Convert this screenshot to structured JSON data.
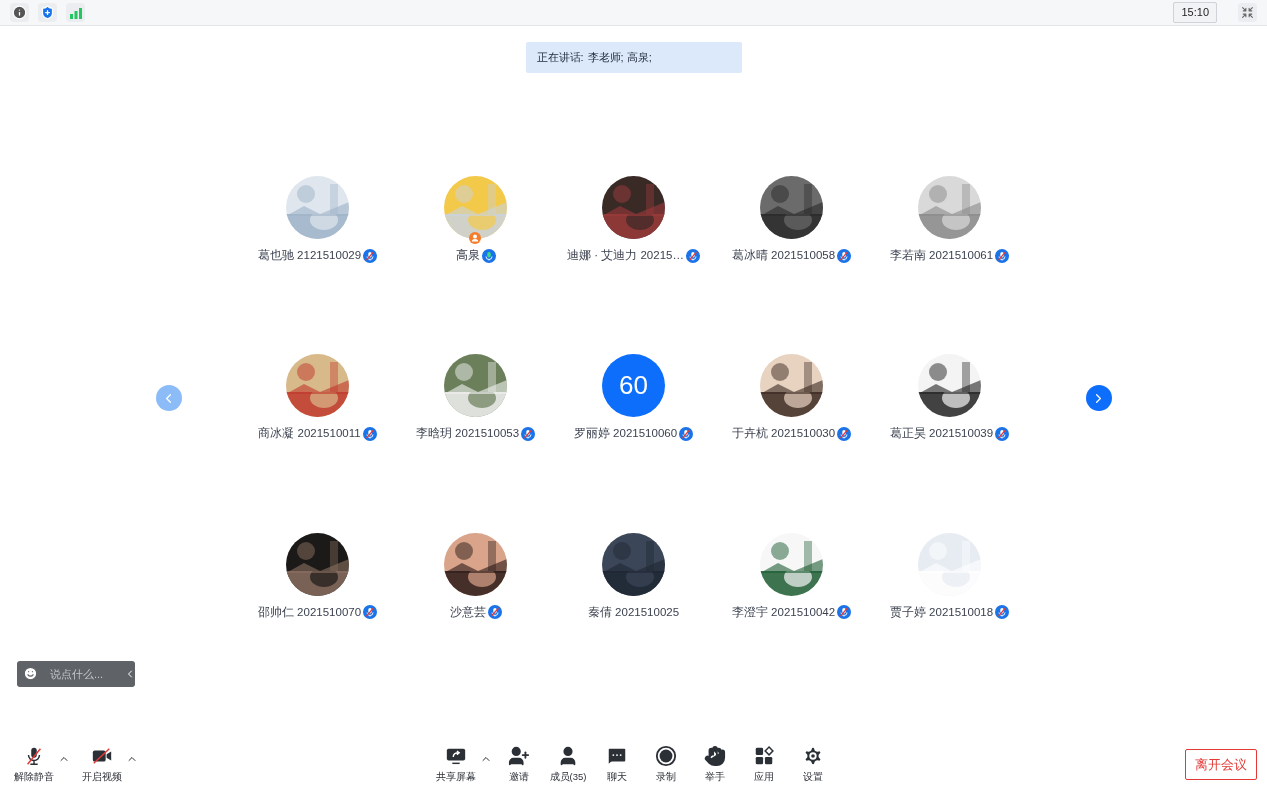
{
  "top_bar": {
    "time": "15:10"
  },
  "speaking_banner": {
    "label": "正在讲话:",
    "names": "李老师; 高泉;"
  },
  "pager": {
    "prev_disabled": true,
    "next_disabled": false
  },
  "participants": [
    {
      "name": "葛也驰 2121510029",
      "muted": true,
      "talking": false,
      "host": false
    },
    {
      "name": "高泉",
      "muted": false,
      "talking": true,
      "host": true
    },
    {
      "name": "迪娜 · 艾迪力 20215…",
      "muted": true,
      "talking": false,
      "host": false
    },
    {
      "name": "葛冰晴 2021510058",
      "muted": true,
      "talking": false,
      "host": false
    },
    {
      "name": "李若南 2021510061",
      "muted": true,
      "talking": false,
      "host": false
    },
    {
      "name": "商冰凝 2021510011",
      "muted": true,
      "talking": false,
      "host": false
    },
    {
      "name": "李晗玥 2021510053",
      "muted": true,
      "talking": false,
      "host": false
    },
    {
      "name": "罗丽婷 2021510060",
      "avatar": {
        "kind": "text",
        "text": "60"
      },
      "muted": true,
      "talking": false,
      "host": false
    },
    {
      "name": "于卉杭 2021510030",
      "muted": true,
      "talking": false,
      "host": false
    },
    {
      "name": "葛正昊 2021510039",
      "muted": true,
      "talking": false,
      "host": false
    },
    {
      "name": "邵帅仁 2021510070",
      "muted": true,
      "talking": false,
      "host": false
    },
    {
      "name": "沙意芸",
      "muted": true,
      "talking": false,
      "host": false
    },
    {
      "name": "秦倩 2021510025",
      "muted": false,
      "talking": false,
      "host": false
    },
    {
      "name": "李澄宇 2021510042",
      "muted": true,
      "talking": false,
      "host": false
    },
    {
      "name": "贾子婷 2021510018",
      "muted": true,
      "talking": false,
      "host": false
    }
  ],
  "chat_box": {
    "placeholder": "说点什么..."
  },
  "toolbar_left": [
    {
      "kind": "audio",
      "label": "解除静音",
      "has_menu": true
    },
    {
      "kind": "video",
      "label": "开启视频",
      "has_menu": true
    }
  ],
  "toolbar_center": [
    {
      "kind": "share",
      "label": "共享屏幕",
      "has_menu": true
    },
    {
      "kind": "invite",
      "label": "邀请",
      "has_menu": false
    },
    {
      "kind": "members",
      "label": "成员(35)",
      "has_menu": false
    },
    {
      "kind": "chat",
      "label": "聊天",
      "has_menu": false
    },
    {
      "kind": "record",
      "label": "录制",
      "has_menu": false
    },
    {
      "kind": "hand",
      "label": "举手",
      "has_menu": false
    },
    {
      "kind": "apps",
      "label": "应用",
      "has_menu": false
    },
    {
      "kind": "settings",
      "label": "设置",
      "has_menu": false
    }
  ],
  "leave_button": {
    "label": "离开会议"
  }
}
